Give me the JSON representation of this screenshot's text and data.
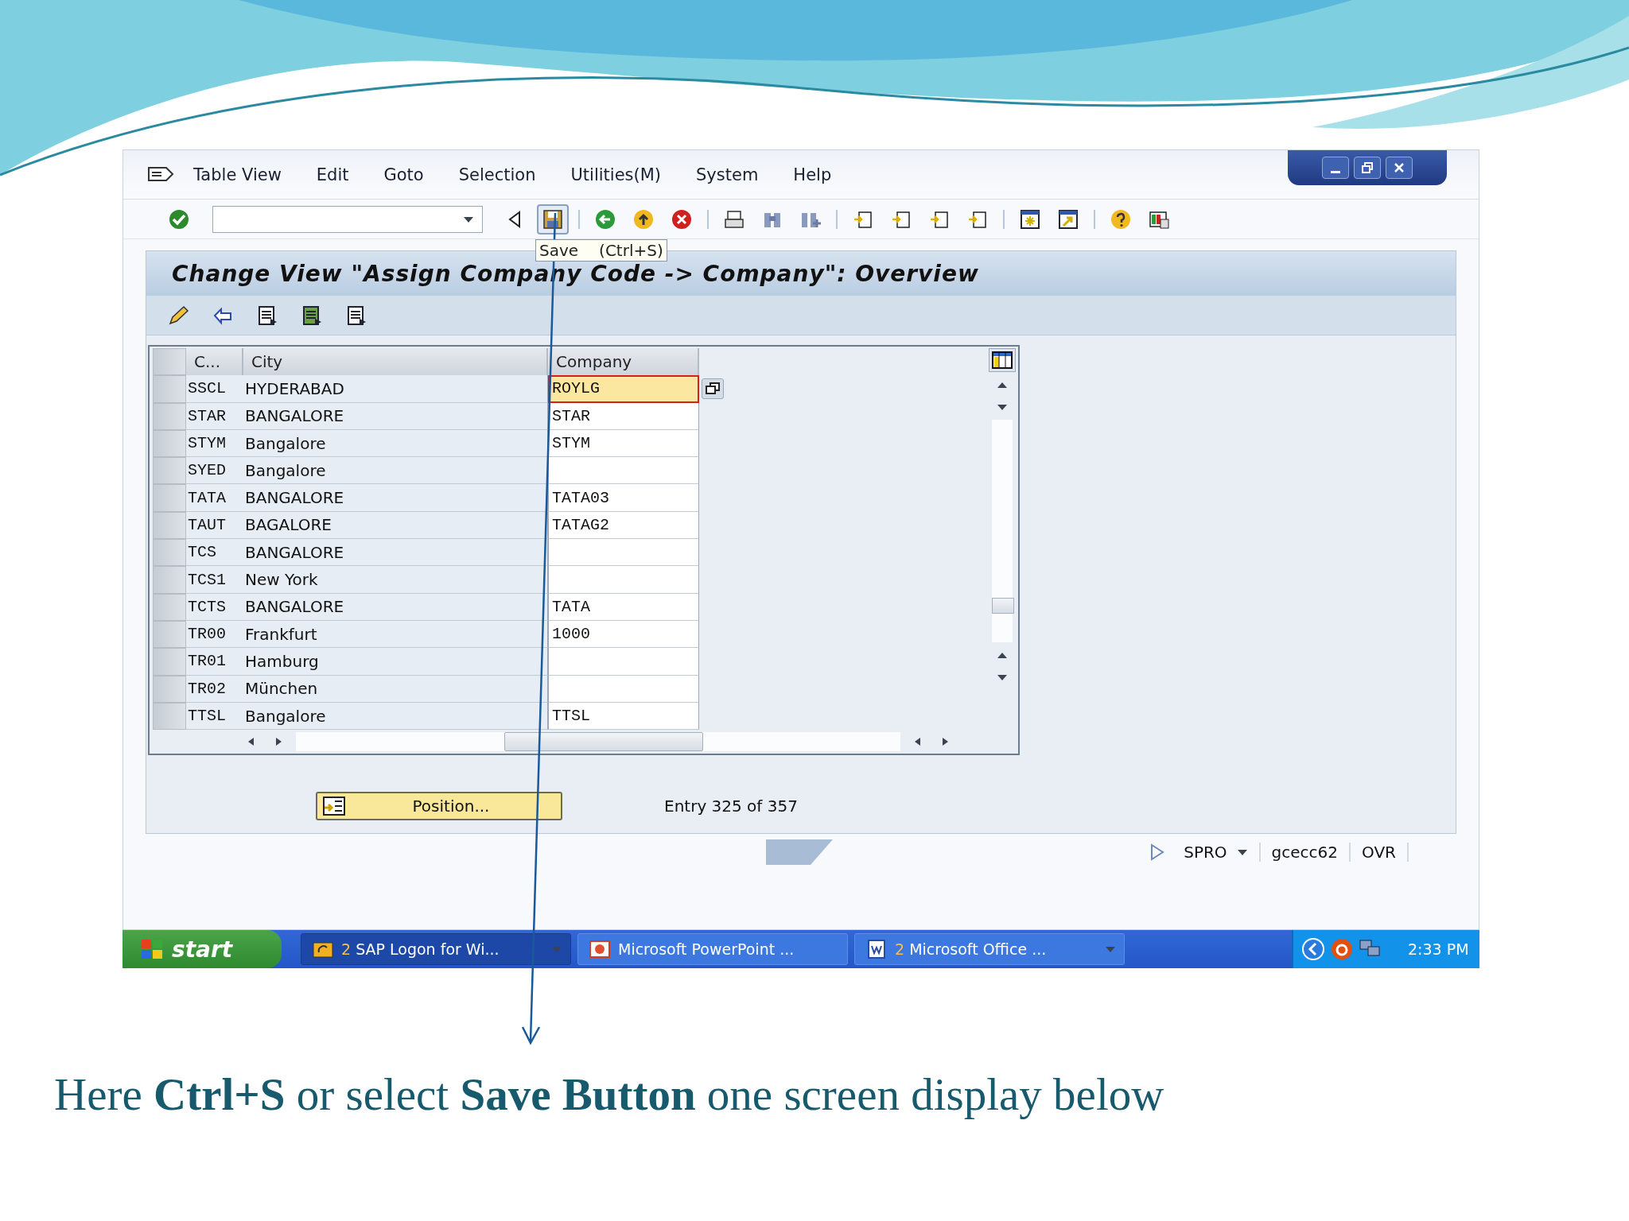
{
  "menu": [
    "Table View",
    "Edit",
    "Goto",
    "Selection",
    "Utilities(M)",
    "System",
    "Help"
  ],
  "tooltip": {
    "label": "Save",
    "shortcut": "(Ctrl+S)"
  },
  "screen_title": "Change View \"Assign Company Code -> Company\": Overview",
  "table": {
    "columns": [
      "C...",
      "City",
      "Company"
    ],
    "rows": [
      {
        "code": "SSCL",
        "city": "HYDERABAD",
        "company": "ROYLG",
        "focused": true
      },
      {
        "code": "STAR",
        "city": "BANGALORE",
        "company": "STAR",
        "focused": false
      },
      {
        "code": "STYM",
        "city": "Bangalore",
        "company": "STYM",
        "focused": false
      },
      {
        "code": "SYED",
        "city": "Bangalore",
        "focused": false
      },
      {
        "code": "TATA",
        "city": "BANGALORE",
        "company": "TATA03",
        "focused": false
      },
      {
        "code": "TAUT",
        "city": "BAGALORE",
        "company": "TATAG2",
        "focused": false
      },
      {
        "code": "TCS",
        "city": "BANGALORE",
        "focused": false
      },
      {
        "code": "TCS1",
        "city": "New York",
        "focused": false
      },
      {
        "code": "TCTS",
        "city": "BANGALORE",
        "company": "TATA",
        "focused": false
      },
      {
        "code": "TR00",
        "city": "Frankfurt",
        "company": "1000",
        "focused": false
      },
      {
        "code": "TR01",
        "city": "Hamburg",
        "focused": false
      },
      {
        "code": "TR02",
        "city": "München",
        "focused": false
      },
      {
        "code": "TTSL",
        "city": "Bangalore",
        "company": "TTSL",
        "focused": false
      }
    ]
  },
  "position_button": "Position...",
  "entry_info": "Entry 325 of 357",
  "status_bar": {
    "transaction": "SPRO",
    "server": "gcecc62",
    "mode": "OVR"
  },
  "taskbar": {
    "start": "start",
    "tasks": [
      {
        "kind": "sap",
        "count": "2",
        "label": "SAP Logon for Wi...",
        "grouped": true,
        "selected": true
      },
      {
        "kind": "powerpoint",
        "label": "Microsoft PowerPoint ...",
        "grouped": false,
        "selected": false
      },
      {
        "kind": "word",
        "count": "2",
        "label": "Microsoft Office ...",
        "grouped": true,
        "selected": false
      }
    ],
    "clock": "2:33 PM"
  },
  "caption": "Here **Ctrl+S** or select **Save Button** one screen display below"
}
